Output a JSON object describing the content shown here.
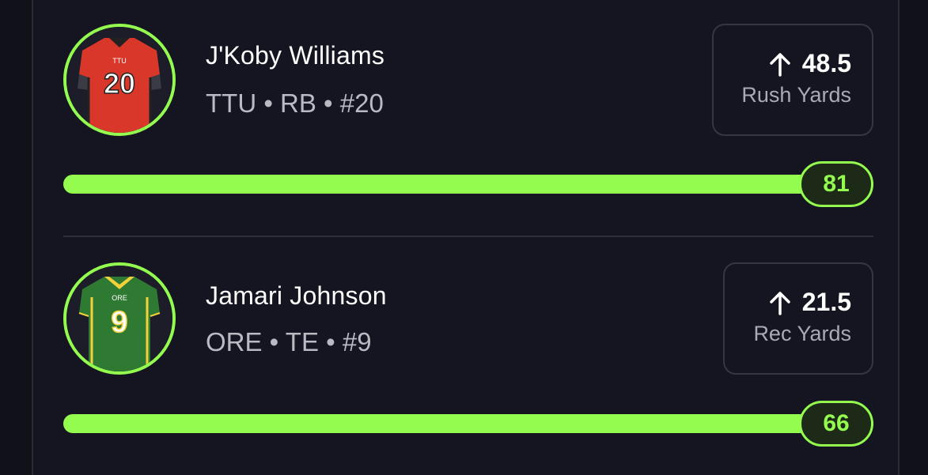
{
  "players": [
    {
      "name": "J'Koby Williams",
      "meta": "TTU • RB • #20",
      "jersey_number": "20",
      "jersey_team_text": "TTU",
      "stat_direction_icon": "arrow-up-icon",
      "stat_value": "48.5",
      "stat_label": "Rush Yards",
      "bar_value": "81",
      "bar_progress": 1.0,
      "jersey_color": "#d8372a"
    },
    {
      "name": "Jamari Johnson",
      "meta": "ORE • TE • #9",
      "jersey_number": "9",
      "jersey_team_text": "ORE",
      "stat_direction_icon": "arrow-up-icon",
      "stat_value": "21.5",
      "stat_label": "Rec Yards",
      "bar_value": "66",
      "bar_progress": 1.0,
      "jersey_color": "#2f7a33"
    }
  ],
  "colors": {
    "accent": "#93fc4f",
    "background": "#101119",
    "card": "#141520"
  }
}
